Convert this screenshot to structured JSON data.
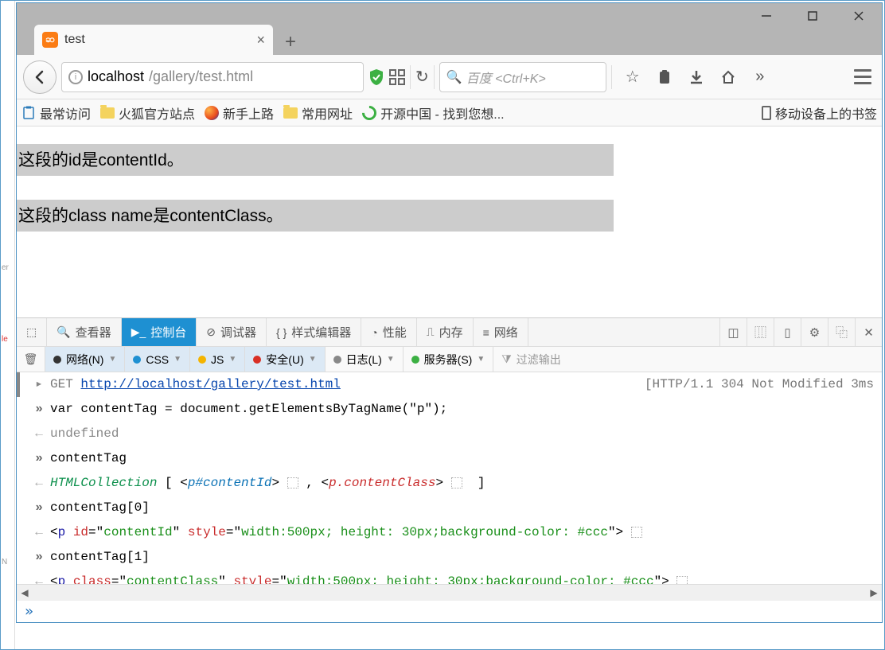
{
  "window": {
    "tab_title": "test",
    "url_host": "localhost",
    "url_path": "/gallery/test.html",
    "search_placeholder": "百度 <Ctrl+K>"
  },
  "bookmarks": {
    "most_visited": "最常访问",
    "firefox_official": "火狐官方站点",
    "getting_started": "新手上路",
    "common_urls": "常用网址",
    "oschina": "开源中国 - 找到您想...",
    "mobile_bookmarks": "移动设备上的书签"
  },
  "page": {
    "p1": "这段的id是contentId。",
    "p2": "这段的class name是contentClass。"
  },
  "devtools": {
    "tabs": {
      "inspector": "查看器",
      "console": "控制台",
      "debugger": "调试器",
      "style": "样式编辑器",
      "perf": "性能",
      "memory": "内存",
      "network": "网络"
    },
    "filters": {
      "net": "网络(N)",
      "css": "CSS",
      "js": "JS",
      "sec": "安全(U)",
      "log": "日志(L)",
      "server": "服务器(S)",
      "filter_placeholder": "过滤输出"
    },
    "console_lines": {
      "req_method": "GET",
      "req_url": "http://localhost/gallery/test.html",
      "req_status": "[HTTP/1.1 304 Not Modified 3ms",
      "l1": "var contentTag = document.getElementsByTagName(\"p\");",
      "l2": "undefined",
      "l3": "contentTag",
      "l4_coll": "HTMLCollection",
      "l4_a": "p#contentId",
      "l4_b": "p.contentClass",
      "l5": "contentTag[0]",
      "l6_tag": "p",
      "l6_attr1": "id",
      "l6_val1": "contentId",
      "l6_attr2": "style",
      "l6_val2": "width:500px; height: 30px;background-color: #ccc",
      "l7": "contentTag[1]",
      "l8_tag": "p",
      "l8_attr1": "class",
      "l8_val1": "contentClass",
      "l8_attr2": "style",
      "l8_val2": "width:500px; height: 30px;background-color: #ccc"
    }
  }
}
